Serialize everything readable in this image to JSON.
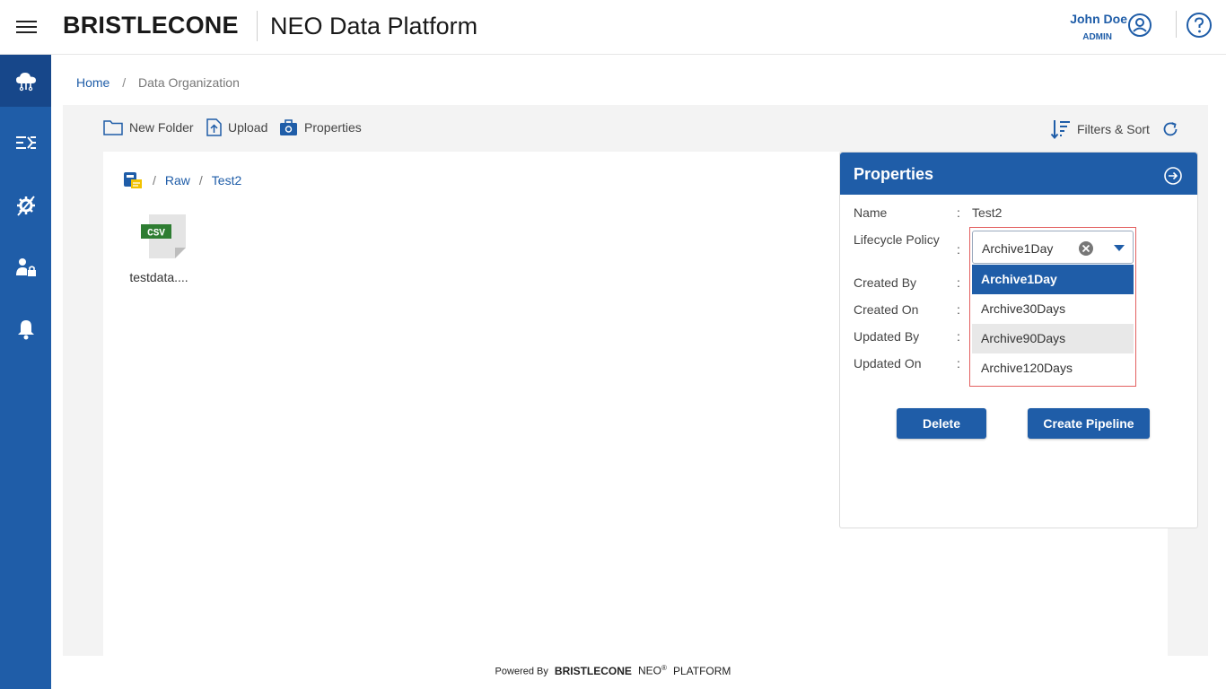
{
  "header": {
    "brand": "BRISTLECONE",
    "app_title": "NEO Data Platform",
    "user_name": "John Doe",
    "user_role": "ADMIN"
  },
  "sidebar": {
    "items": [
      {
        "icon": "cloud-data-icon",
        "active": true
      },
      {
        "icon": "pipeline-flow-icon",
        "active": false
      },
      {
        "icon": "settings-tools-icon",
        "active": false
      },
      {
        "icon": "user-lock-icon",
        "active": false
      },
      {
        "icon": "bell-icon",
        "active": false
      }
    ]
  },
  "breadcrumb": {
    "home": "Home",
    "separator": "/",
    "current": "Data Organization"
  },
  "toolbar": {
    "new_folder": "New Folder",
    "upload": "Upload",
    "properties": "Properties",
    "filters_sort": "Filters & Sort"
  },
  "path": {
    "separator": "/",
    "raw": "Raw",
    "folder": "Test2"
  },
  "files": [
    {
      "badge": "CSV",
      "name": "testdata...."
    }
  ],
  "properties": {
    "title": "Properties",
    "colon": ":",
    "name_label": "Name",
    "name_value": "Test2",
    "lifecycle_label": "Lifecycle Policy",
    "lifecycle_value": "Archive1Day",
    "lifecycle_options": [
      "Archive1Day",
      "Archive30Days",
      "Archive90Days",
      "Archive120Days"
    ],
    "created_by_label": "Created By",
    "created_on_label": "Created On",
    "updated_by_label": "Updated By",
    "updated_on_label": "Updated On",
    "delete_label": "Delete",
    "create_pipeline_label": "Create Pipeline"
  },
  "footer": {
    "powered_by": "Powered By",
    "brand": "BRISTLECONE",
    "neo": "NEO",
    "registered": "®",
    "platform": "PLATFORM"
  },
  "colors": {
    "primary": "#1f5da8",
    "sidebar_active": "#17478a",
    "panel_bg": "#f3f3f3",
    "dropdown_outline": "#e36060",
    "csv_badge": "#2e7d32"
  }
}
